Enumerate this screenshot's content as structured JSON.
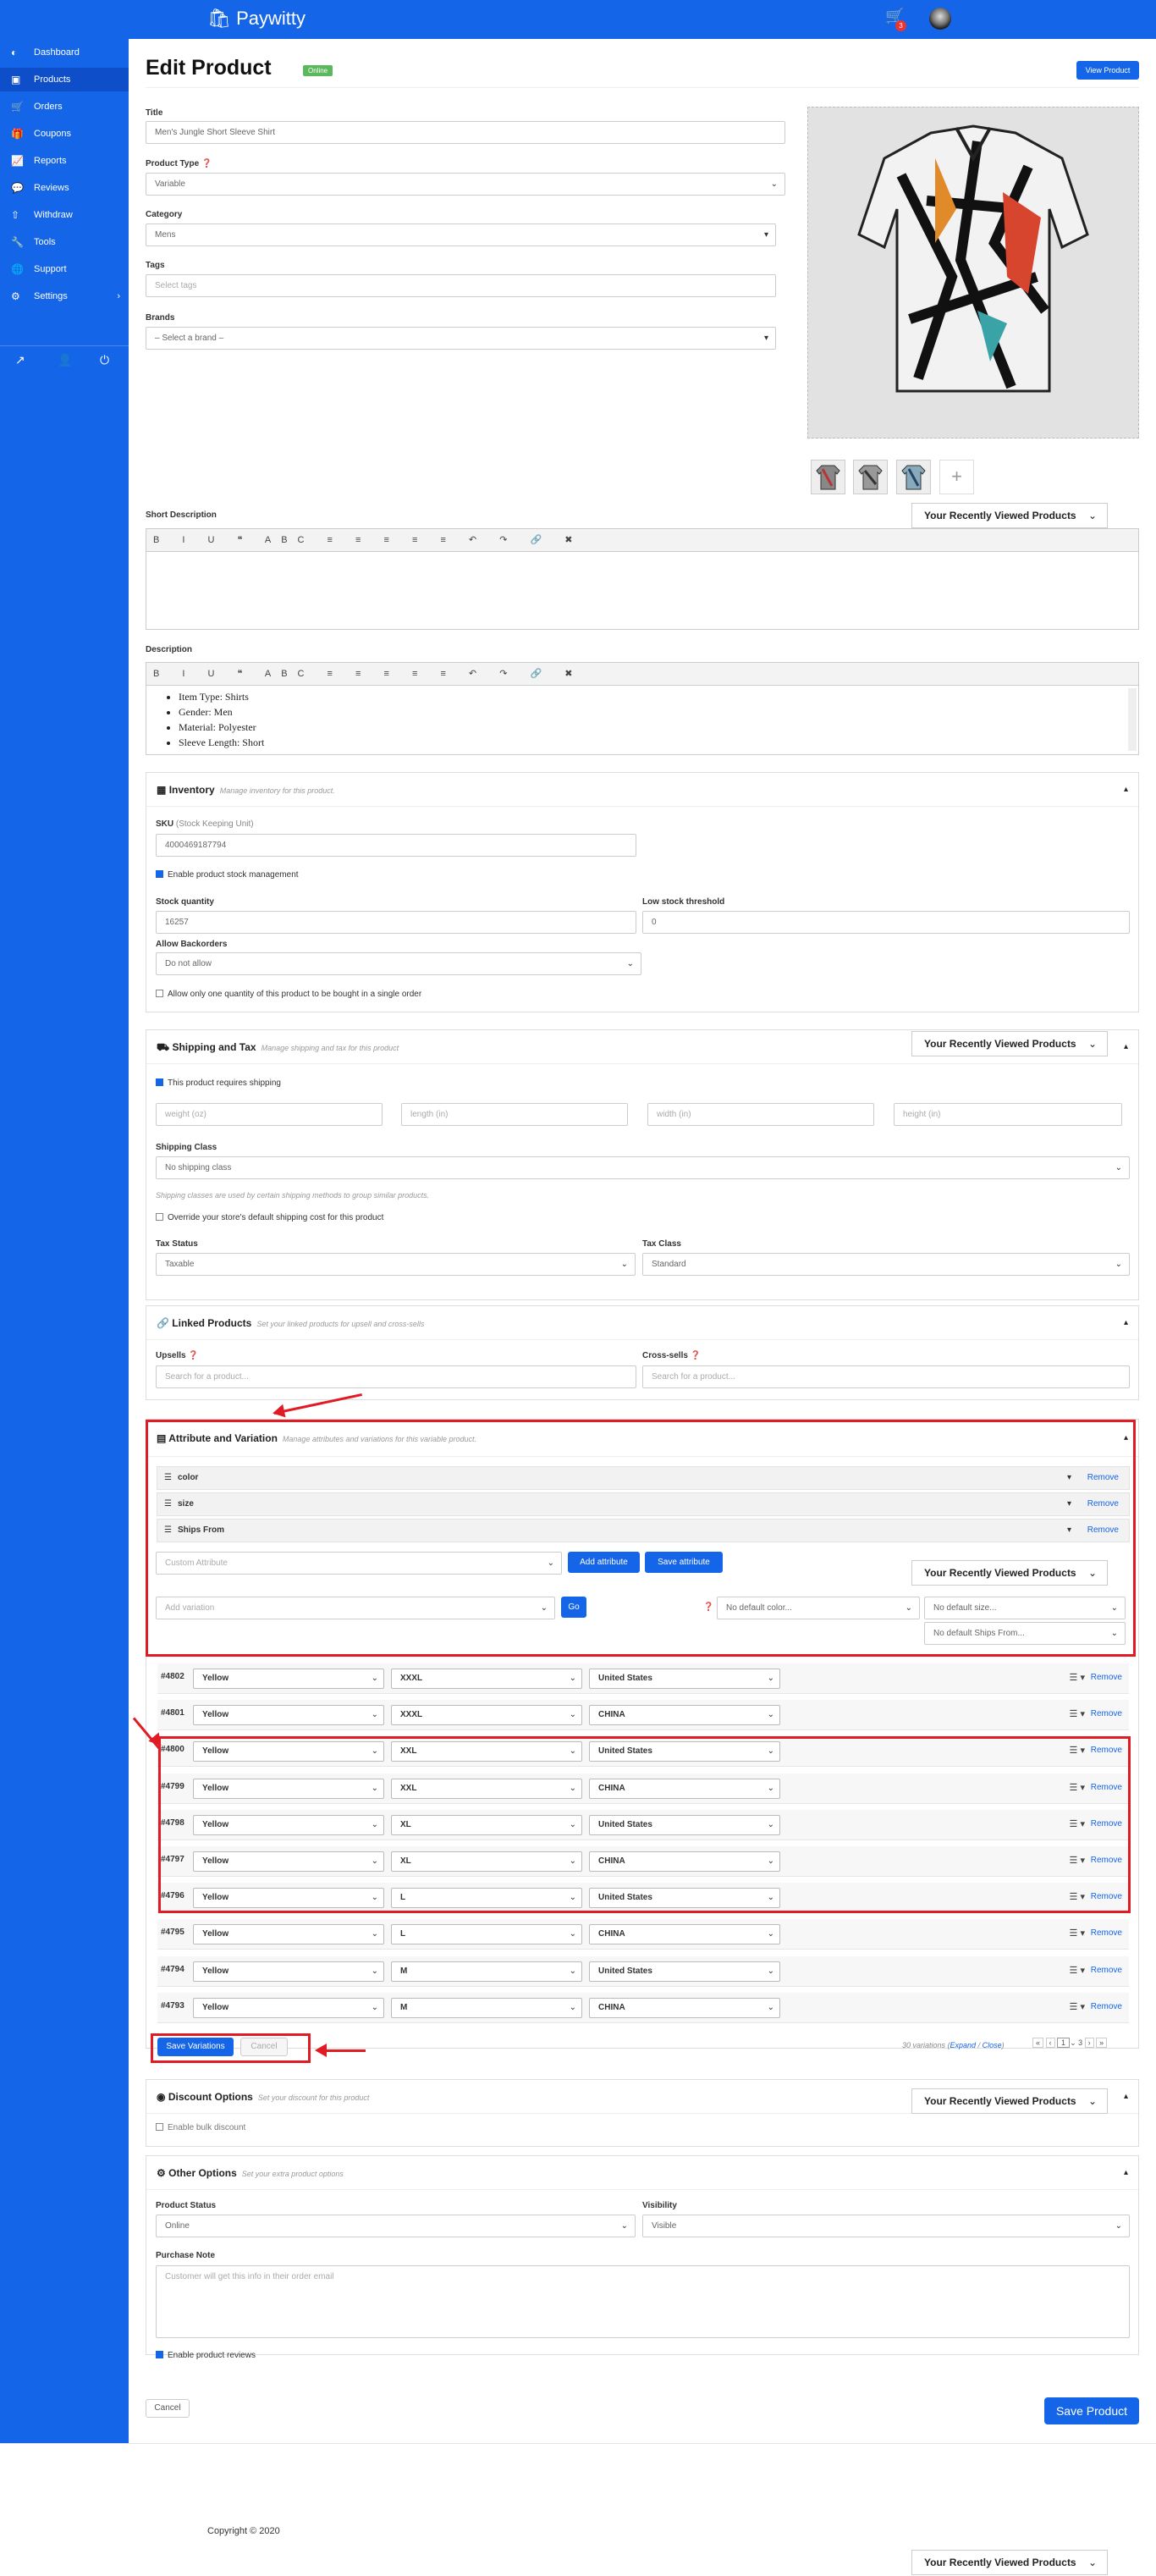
{
  "header": {
    "brand": "Paywitty",
    "cart_count": "3"
  },
  "sidebar": {
    "items": [
      {
        "label": "Dashboard",
        "icon": "dashboard-icon"
      },
      {
        "label": "Products",
        "icon": "products-icon"
      },
      {
        "label": "Orders",
        "icon": "cart-icon"
      },
      {
        "label": "Coupons",
        "icon": "gift-icon"
      },
      {
        "label": "Reports",
        "icon": "chart-icon"
      },
      {
        "label": "Reviews",
        "icon": "comments-icon"
      },
      {
        "label": "Withdraw",
        "icon": "upload-icon"
      },
      {
        "label": "Tools",
        "icon": "wrench-icon"
      },
      {
        "label": "Support",
        "icon": "globe-icon"
      },
      {
        "label": "Settings",
        "icon": "gear-icon"
      }
    ]
  },
  "page": {
    "title": "Edit Product",
    "status_badge": "Online",
    "view_button": "View Product"
  },
  "general": {
    "title_label": "Title",
    "title_value": "Men's Jungle Short Sleeve Shirt",
    "type_label": "Product Type",
    "type_value": "Variable",
    "category_label": "Category",
    "category_value": "Mens",
    "tags_label": "Tags",
    "tags_placeholder": "Select tags",
    "brands_label": "Brands",
    "brands_value": "– Select a brand –"
  },
  "recent_label": "Your Recently Viewed Products",
  "short_description": {
    "label": "Short Description"
  },
  "description": {
    "label": "Description",
    "bullets": [
      "Item Type: Shirts",
      "Gender: Men",
      "Material: Polyester",
      "Sleeve Length: Short"
    ]
  },
  "inventory": {
    "title": "Inventory",
    "subtitle": "Manage inventory for this product.",
    "sku_label": "SKU",
    "sku_hint": "(Stock Keeping Unit)",
    "sku_value": "4000469187794",
    "manage_stock": "Enable product stock management",
    "stock_label": "Stock quantity",
    "stock_value": "16257",
    "low_label": "Low stock threshold",
    "low_value": "0",
    "backorders_label": "Allow Backorders",
    "backorders_value": "Do not allow",
    "sold_individually": "Allow only one quantity of this product to be bought in a single order"
  },
  "shipping": {
    "title": "Shipping and Tax",
    "subtitle": "Manage shipping and tax for this product",
    "requires": "This product requires shipping",
    "weight": "weight (oz)",
    "length": "length (in)",
    "width": "width (in)",
    "height": "height (in)",
    "class_label": "Shipping Class",
    "class_value": "No shipping class",
    "class_note": "Shipping classes are used by certain shipping methods to group similar products.",
    "override": "Override your store's default shipping cost for this product",
    "tax_status_label": "Tax Status",
    "tax_status_value": "Taxable",
    "tax_class_label": "Tax Class",
    "tax_class_value": "Standard"
  },
  "linked": {
    "title": "Linked Products",
    "subtitle": "Set your linked products for upsell and cross-sells",
    "upsells_label": "Upsells",
    "upsells_placeholder": "Search for a product...",
    "cross_label": "Cross-sells",
    "cross_placeholder": "Search for a product..."
  },
  "attributes": {
    "title": "Attribute and Variation",
    "subtitle": "Manage attributes and variations for this variable product.",
    "rows": [
      "color",
      "size",
      "Ships From"
    ],
    "remove": "Remove",
    "custom_attribute": "Custom Attribute",
    "add_attribute": "Add attribute",
    "save_attribute": "Save attribute",
    "add_variation": "Add variation",
    "go": "Go",
    "default_color": "No default color...",
    "default_size": "No default size...",
    "default_ships": "No default Ships From..."
  },
  "variations": [
    {
      "id": "#4802",
      "color": "Yellow",
      "size": "XXXL",
      "ships": "United States"
    },
    {
      "id": "#4801",
      "color": "Yellow",
      "size": "XXXL",
      "ships": "CHINA"
    },
    {
      "id": "#4800",
      "color": "Yellow",
      "size": "XXL",
      "ships": "United States"
    },
    {
      "id": "#4799",
      "color": "Yellow",
      "size": "XXL",
      "ships": "CHINA"
    },
    {
      "id": "#4798",
      "color": "Yellow",
      "size": "XL",
      "ships": "United States"
    },
    {
      "id": "#4797",
      "color": "Yellow",
      "size": "XL",
      "ships": "CHINA"
    },
    {
      "id": "#4796",
      "color": "Yellow",
      "size": "L",
      "ships": "United States"
    },
    {
      "id": "#4795",
      "color": "Yellow",
      "size": "L",
      "ships": "CHINA"
    },
    {
      "id": "#4794",
      "color": "Yellow",
      "size": "M",
      "ships": "United States"
    },
    {
      "id": "#4793",
      "color": "Yellow",
      "size": "M",
      "ships": "CHINA"
    }
  ],
  "variation_actions": {
    "save": "Save Variations",
    "cancel": "Cancel",
    "count": "30 variations",
    "expand": "Expand",
    "close": "Close",
    "page": "1",
    "pages": "3"
  },
  "discount": {
    "title": "Discount Options",
    "subtitle": "Set your discount for this product",
    "bulk": "Enable bulk discount"
  },
  "other": {
    "title": "Other Options",
    "subtitle": "Set your extra product options",
    "status_label": "Product Status",
    "status_value": "Online",
    "visibility_label": "Visibility",
    "visibility_value": "Visible",
    "note_label": "Purchase Note",
    "note_placeholder": "Customer will get this info in their order email",
    "reviews": "Enable product reviews"
  },
  "bottom": {
    "cancel": "Cancel",
    "save": "Save Product"
  },
  "footer": {
    "copyright": "Copyright © 2020"
  }
}
